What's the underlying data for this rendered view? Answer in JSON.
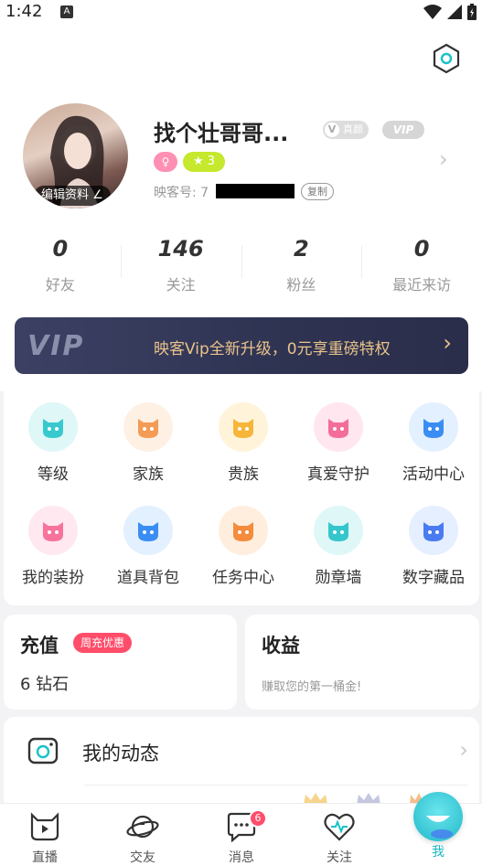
{
  "status_bar": {
    "time": "1:42",
    "notif_letter": "A"
  },
  "profile": {
    "username": "找个壮哥哥...",
    "badge_real": "真颜",
    "badge_real_v": "V",
    "badge_vip": "VIP",
    "level": "3",
    "account_label": "映客号: 7",
    "copy_label": "复制",
    "edit_label": "编辑资料"
  },
  "stats": [
    {
      "value": "0",
      "label": "好友"
    },
    {
      "value": "146",
      "label": "关注"
    },
    {
      "value": "2",
      "label": "粉丝"
    },
    {
      "value": "0",
      "label": "最近来访"
    }
  ],
  "vip_banner": {
    "logo": "VIP",
    "text": "映客Vip全新升级，0元享重磅特权"
  },
  "grid": [
    {
      "label": "等级",
      "icon": "level-icon",
      "bg": "#dff7f7",
      "color": "#38c9cf"
    },
    {
      "label": "家族",
      "icon": "family-icon",
      "bg": "#fff0e4",
      "color": "#f49b55"
    },
    {
      "label": "贵族",
      "icon": "noble-icon",
      "bg": "#fff4d9",
      "color": "#f7b53a"
    },
    {
      "label": "真爱守护",
      "icon": "guard-icon",
      "bg": "#ffe6ef",
      "color": "#f36d98"
    },
    {
      "label": "活动中心",
      "icon": "activity-icon",
      "bg": "#e3f0ff",
      "color": "#3a8ef3"
    },
    {
      "label": "我的装扮",
      "icon": "outfit-icon",
      "bg": "#ffe8ef",
      "color": "#f7739b"
    },
    {
      "label": "道具背包",
      "icon": "backpack-icon",
      "bg": "#e2f0ff",
      "color": "#3a8ef3"
    },
    {
      "label": "任务中心",
      "icon": "task-icon",
      "bg": "#ffeede",
      "color": "#f48b3d"
    },
    {
      "label": "勋章墙",
      "icon": "medal-icon",
      "bg": "#dff7f7",
      "color": "#35c6cc"
    },
    {
      "label": "数字藏品",
      "icon": "collection-icon",
      "bg": "#e5efff",
      "color": "#4a7bf0"
    }
  ],
  "recharge": {
    "title": "充值",
    "promo": "周充优惠",
    "balance": "6 钻石"
  },
  "earnings": {
    "title": "收益",
    "sub": "赚取您的第一桶金!"
  },
  "dynamics": {
    "label": "我的动态"
  },
  "tabs": [
    {
      "label": "直播"
    },
    {
      "label": "交友"
    },
    {
      "label": "消息",
      "badge": "6"
    },
    {
      "label": "关注"
    },
    {
      "label": "我"
    }
  ]
}
